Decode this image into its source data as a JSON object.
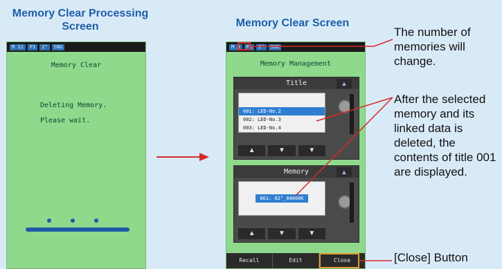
{
  "captions": {
    "left": "Memory Clear Processing Screen",
    "right": "Memory Clear Screen"
  },
  "notes": {
    "memories_change": "The number of memories will change.",
    "deleted": "After the selected memory and its linked data is deleted, the contents of title 001 are displayed.",
    "close_button": "[Close] Button"
  },
  "left_screen": {
    "status": [
      "M 11",
      "P1",
      "2°",
      "SNG"
    ],
    "title": "Memory Clear",
    "line1": "Deleting Memory.",
    "line2": "Please wait."
  },
  "right_screen": {
    "status": [
      "M 3",
      "P1",
      "2°",
      "SNG"
    ],
    "title": "Memory Management",
    "title_panel": {
      "header": "Title",
      "rows": [
        "001: LED-No.2",
        "002: LED-No.3",
        "003: LED-No.4"
      ],
      "selected_index": 0
    },
    "memory_panel": {
      "header": "Memory",
      "rows": [
        "001: 02°_04000K"
      ]
    },
    "buttons": {
      "recall": "Recall",
      "edit": "Edit",
      "close": "Close"
    }
  },
  "colors": {
    "screen_bg": "#8ed98c",
    "caption": "#1d5fa8",
    "annotation_line": "#d62a2a",
    "highlight_close": "#e29a2f",
    "page_bg": "#d9eaf7"
  }
}
